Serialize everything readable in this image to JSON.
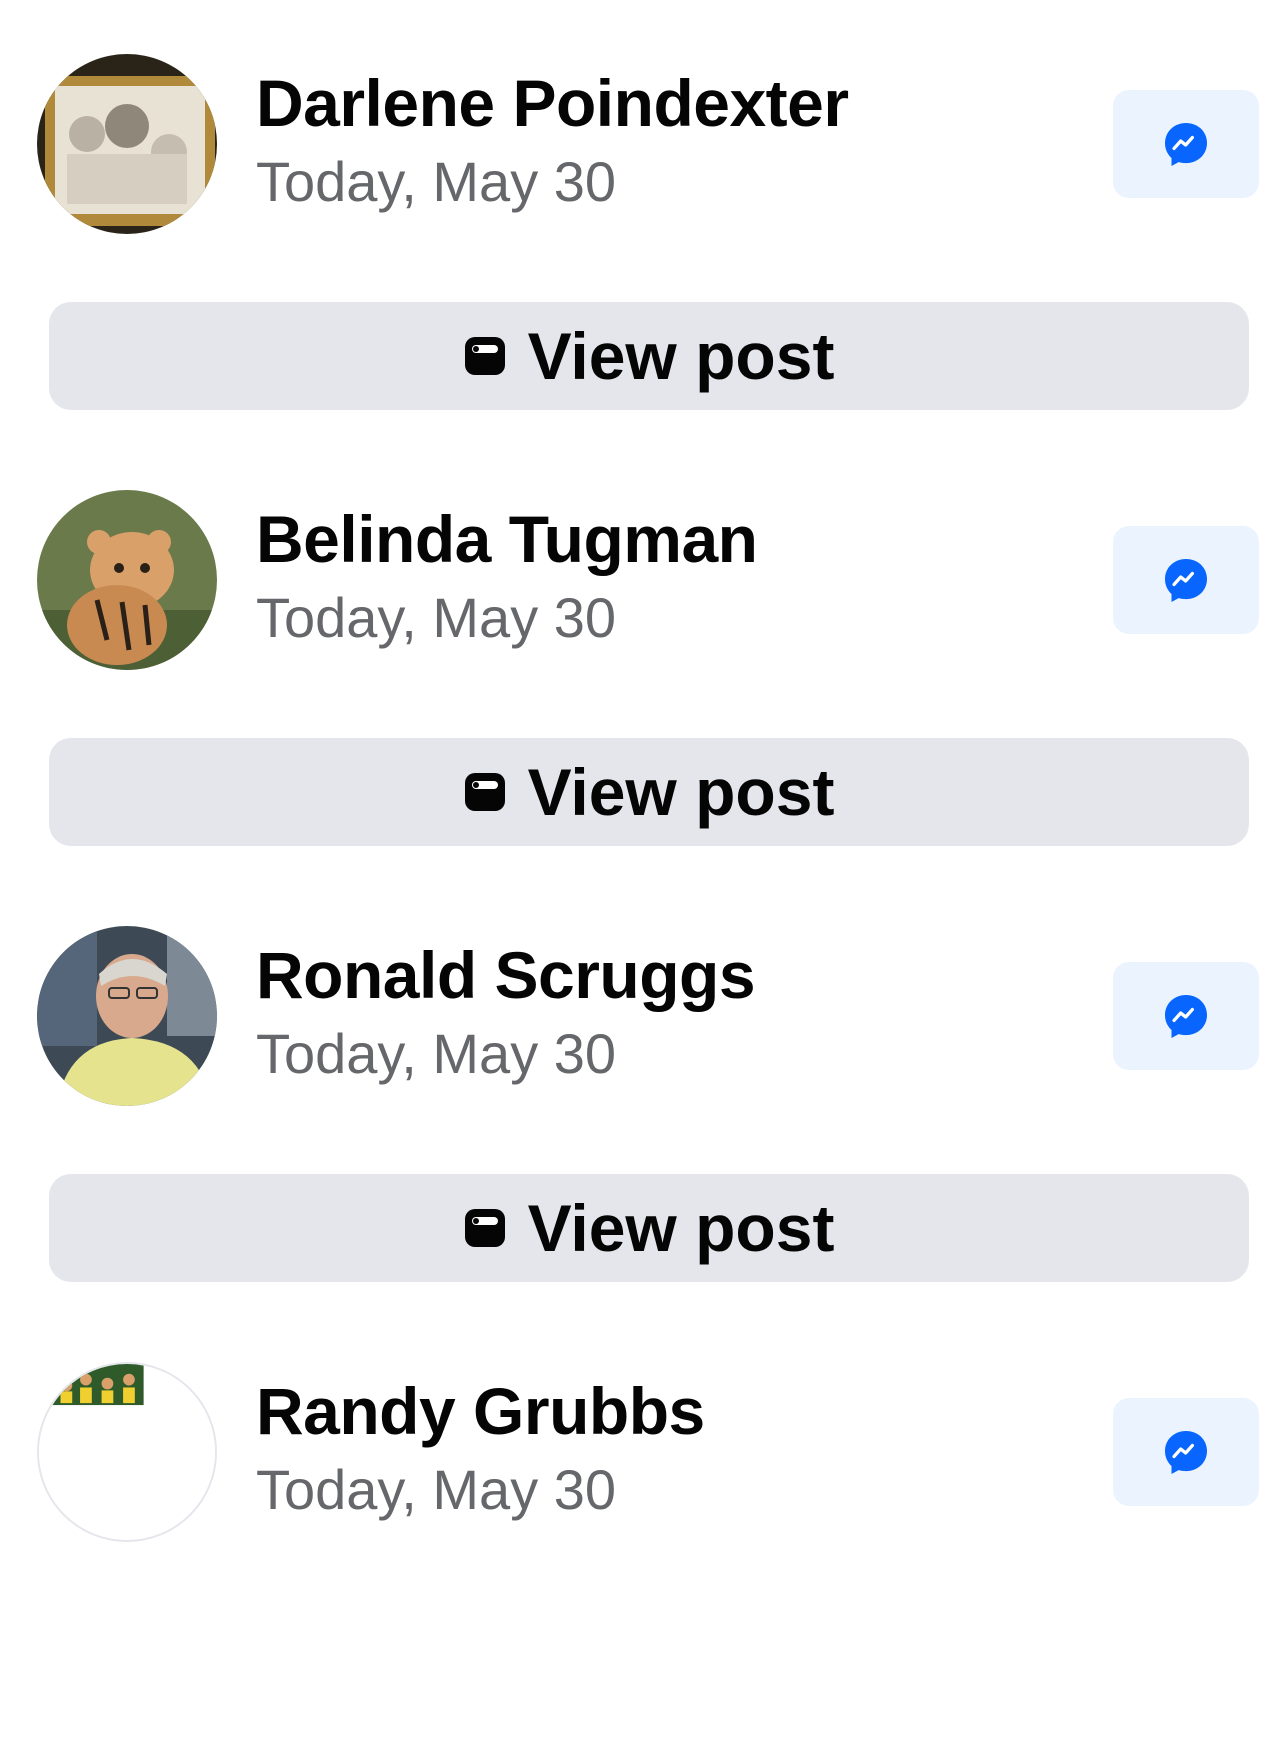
{
  "colors": {
    "name_text": "#050505",
    "date_text": "#65676b",
    "view_button_bg": "#e4e6eb",
    "messenger_button_bg": "#ebf3fe",
    "messenger_blue": "#0866ff"
  },
  "icons": {
    "avatar": "avatar",
    "messenger": "messenger-icon",
    "view_post": "post-icon"
  },
  "entries": [
    {
      "name": "Darlene Poindexter",
      "date": "Today, May 30",
      "view_label": "View post"
    },
    {
      "name": "Belinda Tugman",
      "date": "Today, May 30",
      "view_label": "View post"
    },
    {
      "name": "Ronald Scruggs",
      "date": "Today, May 30",
      "view_label": "View post"
    },
    {
      "name": "Randy Grubbs",
      "date": "Today, May 30"
    }
  ]
}
